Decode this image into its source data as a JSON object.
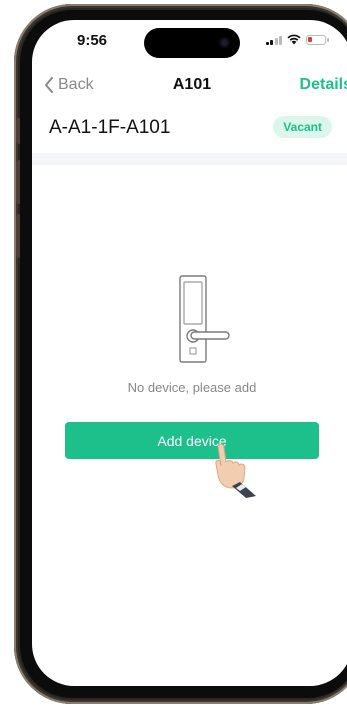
{
  "status_bar": {
    "time": "9:56"
  },
  "nav": {
    "back_label": "Back",
    "title": "A101",
    "details_label": "Details"
  },
  "room": {
    "code": "A-A1-1F-A101",
    "status": "Vacant"
  },
  "empty_state": {
    "message": "No device, please add",
    "icon": "door-lock-icon"
  },
  "actions": {
    "add_device_label": "Add device"
  },
  "colors": {
    "accent": "#1dbf8a",
    "badge_bg": "#dcf6ec",
    "badge_text": "#1ec08c"
  }
}
